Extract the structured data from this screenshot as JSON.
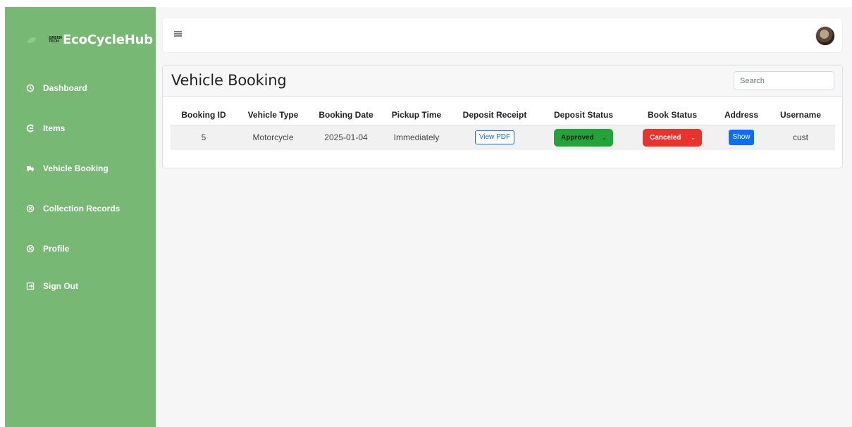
{
  "brand": {
    "logo_text": "GREEN TECH",
    "name": "EcoCycleHub"
  },
  "sidebar": {
    "items": [
      {
        "label": "Dashboard",
        "icon": "dashboard-icon"
      },
      {
        "label": "Items",
        "icon": "items-icon"
      },
      {
        "label": "Vehicle Booking",
        "icon": "truck-icon"
      },
      {
        "label": "Collection Records",
        "icon": "records-icon"
      },
      {
        "label": "Profile",
        "icon": "profile-icon"
      },
      {
        "label": "Sign Out",
        "icon": "sign-out-icon"
      }
    ]
  },
  "header": {
    "menu_icon": "hamburger-icon",
    "avatar_icon": "avatar-icon"
  },
  "page": {
    "title": "Vehicle Booking",
    "search_placeholder": "Search"
  },
  "table": {
    "columns": [
      "Booking ID",
      "Vehicle Type",
      "Booking Date",
      "Pickup Time",
      "Deposit Receipt",
      "Deposit Status",
      "Book Status",
      "Address",
      "Username"
    ],
    "rows": [
      {
        "booking_id": "5",
        "vehicle_type": "Motorcycle",
        "booking_date": "2025-01-04",
        "pickup_time": "Immediately",
        "deposit_receipt": "View PDF",
        "deposit_status": "Approved",
        "book_status": "Canceled",
        "address": "Show",
        "username": "cust"
      }
    ]
  },
  "colors": {
    "sidebar_bg": "#76b874",
    "approved": "#23a33a",
    "canceled": "#e8342c",
    "primary": "#0d6efd"
  }
}
